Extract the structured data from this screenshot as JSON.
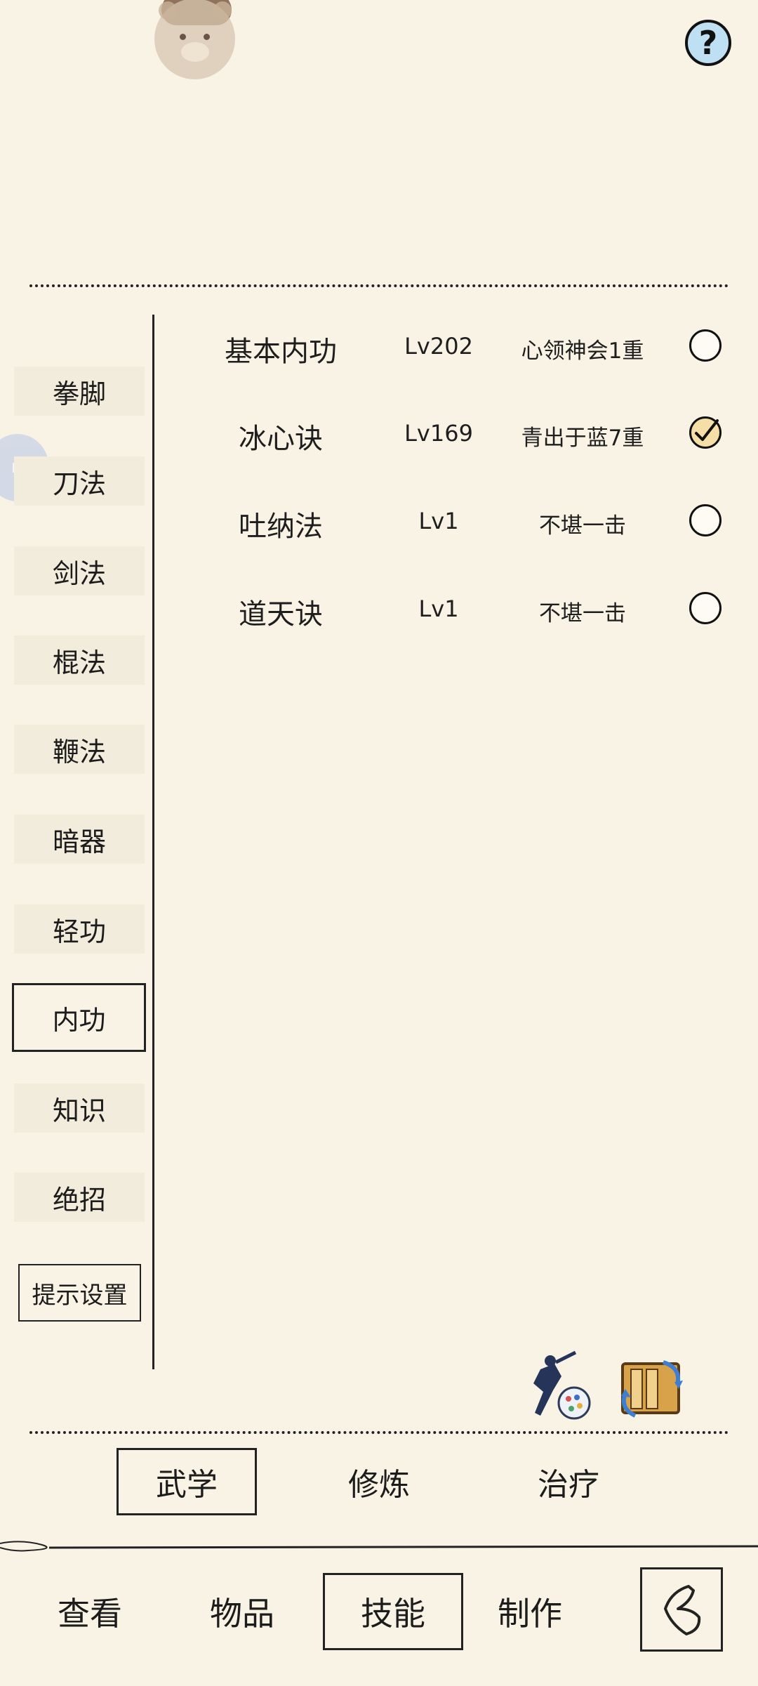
{
  "header": {
    "help_label": "?",
    "avatar_icon": "bear-avatar-icon"
  },
  "sidebar": {
    "items": [
      {
        "label": "拳脚",
        "selected": false
      },
      {
        "label": "刀法",
        "selected": false
      },
      {
        "label": "剑法",
        "selected": false
      },
      {
        "label": "棍法",
        "selected": false
      },
      {
        "label": "鞭法",
        "selected": false
      },
      {
        "label": "暗器",
        "selected": false
      },
      {
        "label": "轻功",
        "selected": false
      },
      {
        "label": "内功",
        "selected": true
      },
      {
        "label": "知识",
        "selected": false
      },
      {
        "label": "绝招",
        "selected": false
      }
    ],
    "settings_label": "提示设置"
  },
  "skills": [
    {
      "name": "基本内功",
      "level": "Lv202",
      "rank": "心领神会1重",
      "checked": false
    },
    {
      "name": "冰心诀",
      "level": "Lv169",
      "rank": "青出于蓝7重",
      "checked": true
    },
    {
      "name": "吐纳法",
      "level": "Lv1",
      "rank": "不堪一击",
      "checked": false
    },
    {
      "name": "道天诀",
      "level": "Lv1",
      "rank": "不堪一击",
      "checked": false
    }
  ],
  "actions": {
    "left_icon": "martial-artist-icon",
    "right_icon": "scroll-swap-icon"
  },
  "sub_tabs": [
    {
      "label": "武学",
      "selected": true
    },
    {
      "label": "修炼",
      "selected": false
    },
    {
      "label": "治疗",
      "selected": false
    }
  ],
  "bottom_nav": [
    {
      "label": "查看",
      "selected": false
    },
    {
      "label": "物品",
      "selected": false
    },
    {
      "label": "技能",
      "selected": true
    },
    {
      "label": "制作",
      "selected": false
    }
  ],
  "back_icon": "back-arrow-icon",
  "colors": {
    "background": "#f8f3e5",
    "text": "#1e1e1e",
    "help_button": "#bfe0f2",
    "check_fill": "#f6dfa6"
  }
}
